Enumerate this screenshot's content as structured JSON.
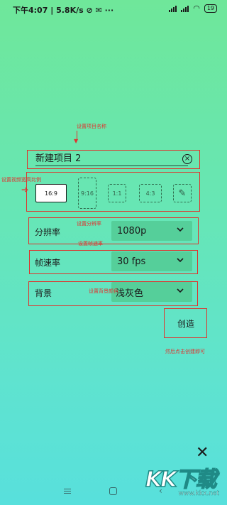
{
  "status_bar": {
    "time": "下午4:07",
    "speed": "5.8K/s",
    "battery": "19"
  },
  "annotations": {
    "name": "设置项目名称",
    "ratio": "设置视频宽高比例",
    "resolution": "设置分辨率",
    "framerate": "设置帧速率",
    "background": "设置背景颜色",
    "create": "然后点击创建即可"
  },
  "project": {
    "name_value": "新建项目 2",
    "clear_icon": "close-circle-icon"
  },
  "ratios": {
    "items": [
      "16:9",
      "9:16",
      "1:1",
      "4:3"
    ],
    "selected": "16:9",
    "edit_icon": "pencil-icon"
  },
  "settings": {
    "resolution_label": "分辨率",
    "resolution_value": "1080p",
    "framerate_label": "帧速率",
    "framerate_value": "30 fps",
    "background_label": "背景",
    "background_value": "浅灰色"
  },
  "actions": {
    "create_label": "创造",
    "close_icon": "close-icon"
  },
  "watermark": {
    "text": "KK下载",
    "url": "www.kkx.net"
  },
  "colors": {
    "annotation": "#e0332f",
    "select_bg": "#55cf9a",
    "bg_top": "#6fe79a",
    "bg_bottom": "#58e0dc"
  }
}
